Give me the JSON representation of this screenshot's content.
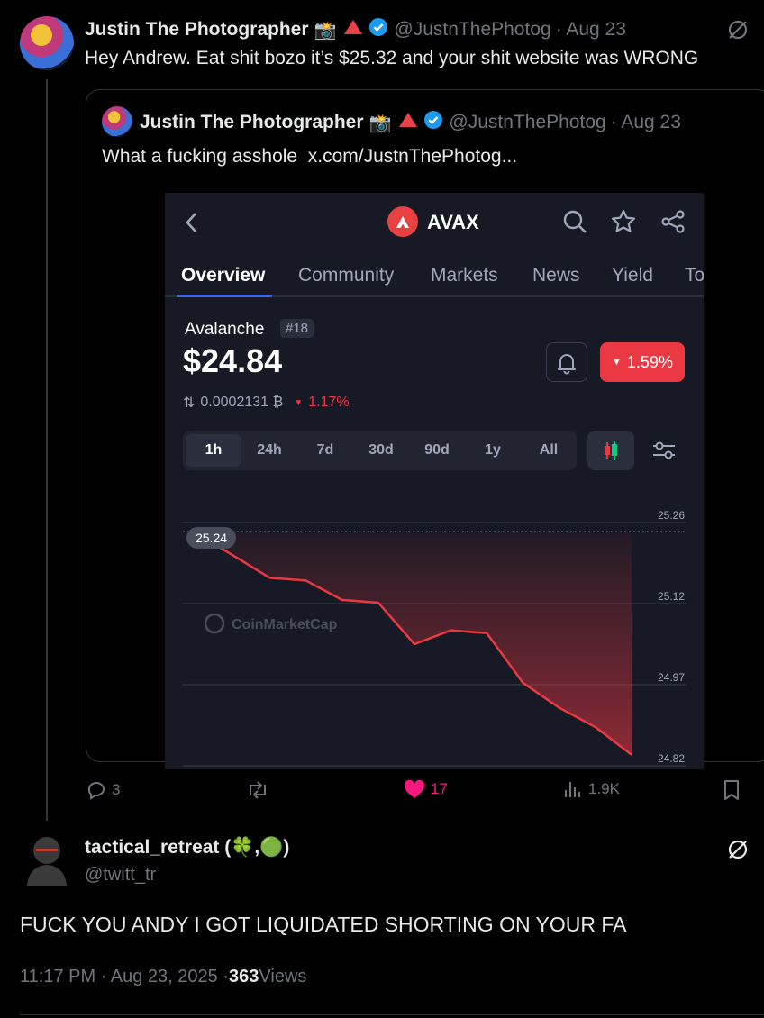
{
  "tweet1": {
    "display_name": "Justin The Photographer",
    "emoji": "📸",
    "handle": "@JustnThePhotog",
    "date": "· Aug 23",
    "text": "Hey Andrew. Eat shit bozo it’s $25.32 and your shit website was WRONG"
  },
  "quote": {
    "display_name": "Justin The Photographer",
    "emoji": "📸",
    "handle": "@JustnThePhotog",
    "date": "· Aug 23",
    "text": "What a fucking asshole  x.com/JustnThePhotog..."
  },
  "app": {
    "ticker": "AVAX",
    "tabs": [
      "Overview",
      "Community",
      "Markets",
      "News",
      "Yield",
      "To"
    ],
    "coin_name": "Avalanche",
    "rank": "#18",
    "price": "$24.84",
    "change_badge": "1.59%",
    "btc_price": "0.0002131 ₿",
    "btc_change": "1.17%",
    "timeframes": [
      "1h",
      "24h",
      "7d",
      "30d",
      "90d",
      "1y",
      "All"
    ],
    "watermark": "CoinMarketCap",
    "accent_red": "#ea3943",
    "chart_data": {
      "type": "line",
      "title": "",
      "x": [
        0,
        1,
        2,
        3,
        4,
        5,
        6,
        7,
        8,
        9,
        10,
        11,
        12
      ],
      "values": [
        25.24,
        25.2,
        25.16,
        25.155,
        25.12,
        25.115,
        25.04,
        25.065,
        25.06,
        24.97,
        24.925,
        24.89,
        24.84
      ],
      "ylim": [
        24.82,
        25.26
      ],
      "y_ticks": [
        "25.26",
        "25.12",
        "24.97",
        "24.82"
      ],
      "start_label": "25.24",
      "grid": true
    }
  },
  "actions": {
    "replies": "3",
    "likes": "17",
    "views": "1.9K"
  },
  "tweet2": {
    "display_name": "tactical_retreat (",
    "name_suffix": ")",
    "name_emoji1": "🍀",
    "name_sep": ",",
    "name_emoji2": "🟢",
    "handle": "@twitt_tr",
    "text": "FUCK YOU ANDY I GOT LIQUIDATED SHORTING ON YOUR FA",
    "time": "11:17 PM · Aug 23, 2025 · ",
    "views_count": "363",
    "views_label": " Views"
  }
}
